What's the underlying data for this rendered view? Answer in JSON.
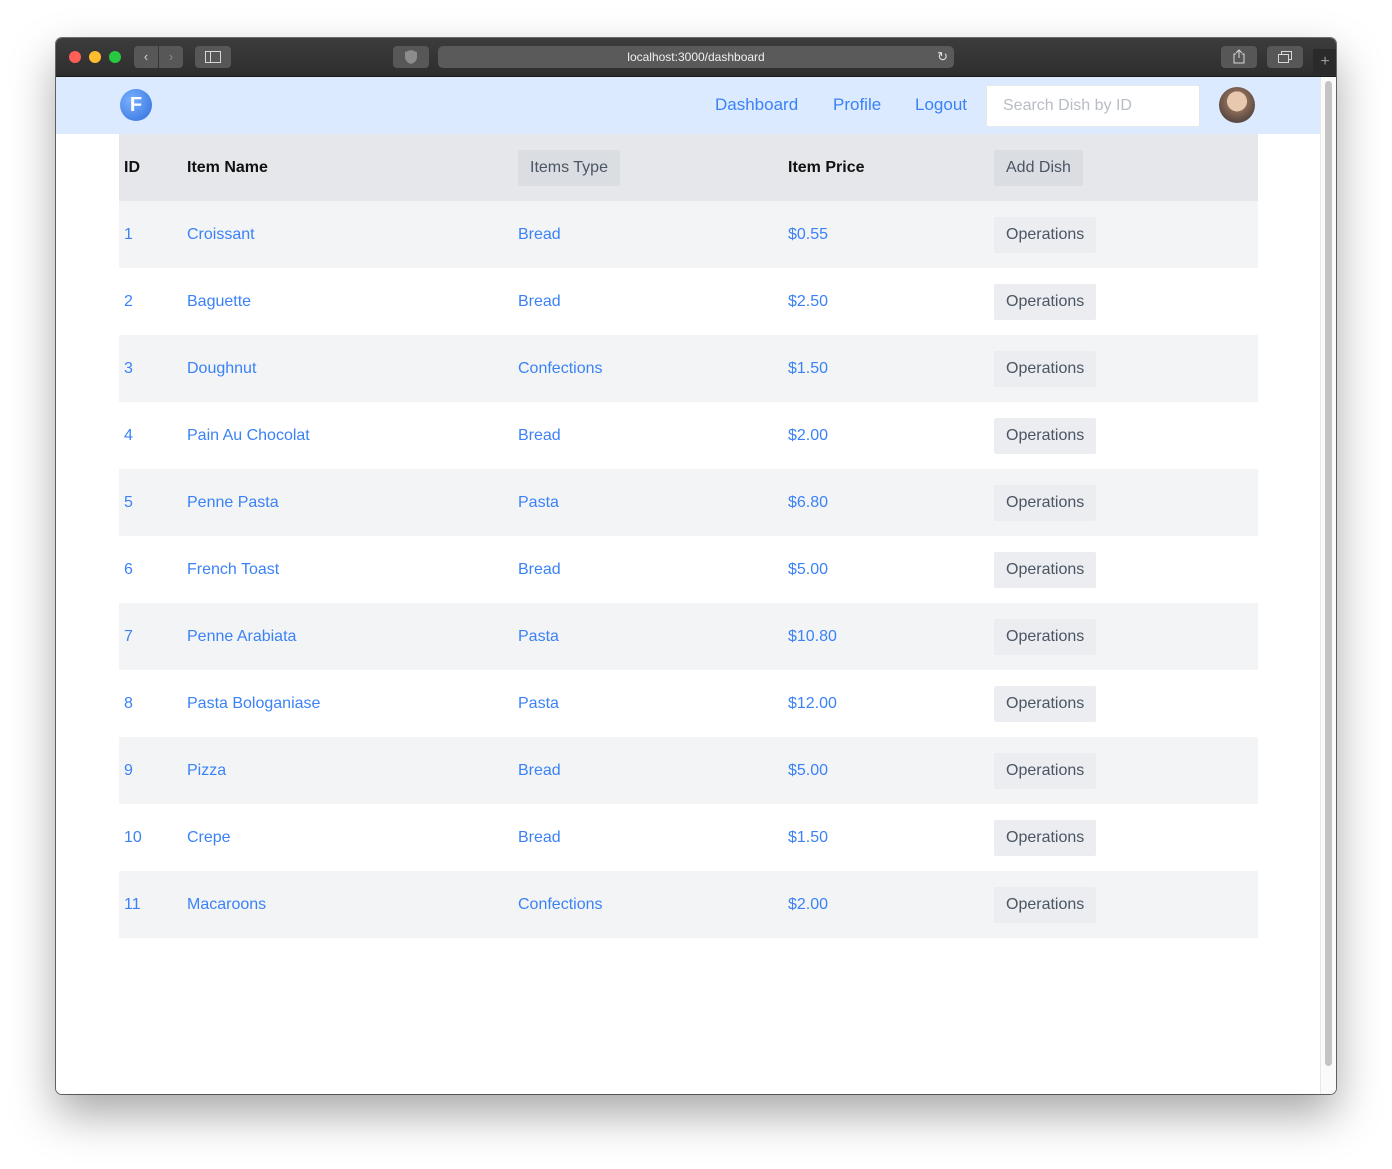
{
  "browser": {
    "url": "localhost:3000/dashboard",
    "nav_back": "‹",
    "nav_forward": "›",
    "new_tab": "+"
  },
  "navbar": {
    "logo_letter": "F",
    "links": [
      "Dashboard",
      "Profile",
      "Logout"
    ],
    "search_placeholder": "Search Dish by ID"
  },
  "table": {
    "headers": {
      "id": "ID",
      "name": "Item Name",
      "type": "Items Type",
      "price": "Item Price",
      "add": "Add Dish"
    },
    "operations_label": "Operations",
    "rows": [
      {
        "id": "1",
        "name": "Croissant",
        "type": "Bread",
        "price": "$0.55"
      },
      {
        "id": "2",
        "name": "Baguette",
        "type": "Bread",
        "price": "$2.50"
      },
      {
        "id": "3",
        "name": "Doughnut",
        "type": "Confections",
        "price": "$1.50"
      },
      {
        "id": "4",
        "name": "Pain Au Chocolat",
        "type": "Bread",
        "price": "$2.00"
      },
      {
        "id": "5",
        "name": "Penne Pasta",
        "type": "Pasta",
        "price": "$6.80"
      },
      {
        "id": "6",
        "name": "French Toast",
        "type": "Bread",
        "price": "$5.00"
      },
      {
        "id": "7",
        "name": "Penne Arabiata",
        "type": "Pasta",
        "price": "$10.80"
      },
      {
        "id": "8",
        "name": "Pasta Bologaniase",
        "type": "Pasta",
        "price": "$12.00"
      },
      {
        "id": "9",
        "name": "Pizza",
        "type": "Bread",
        "price": "$5.00"
      },
      {
        "id": "10",
        "name": "Crepe",
        "type": "Bread",
        "price": "$1.50"
      },
      {
        "id": "11",
        "name": "Macaroons",
        "type": "Confections",
        "price": "$2.00"
      }
    ]
  },
  "colors": {
    "navbar_bg": "#dbeafe",
    "link": "#3b82f6",
    "header_row": "#e5e7eb",
    "stripe": "#f3f4f6"
  }
}
